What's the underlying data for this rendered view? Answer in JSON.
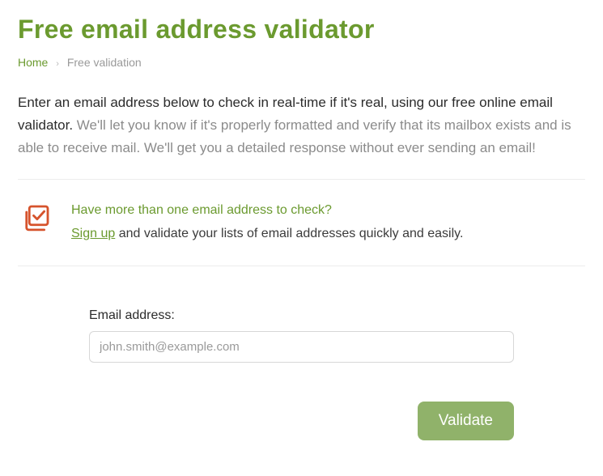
{
  "header": {
    "title": "Free email address validator"
  },
  "breadcrumb": {
    "home_label": "Home",
    "separator": "›",
    "current_label": "Free validation"
  },
  "intro": {
    "lead": "Enter an email address below to check in real-time if it's real, ",
    "sub": "using our free online email validator.",
    "rest": " We'll let you know if it's properly formatted and verify that its mailbox exists and is able to receive mail. We'll get you a detailed response without ever sending an email!"
  },
  "callout": {
    "icon_name": "multi-check-icon",
    "question": "Have more than one email address to check?",
    "signup_label": "Sign up",
    "rest": " and validate your lists of email addresses quickly and easily."
  },
  "form": {
    "email_label": "Email address:",
    "email_placeholder": "john.smith@example.com",
    "email_value": "",
    "validate_label": "Validate"
  },
  "colors": {
    "accent": "#6b9a2f",
    "icon": "#d6532c",
    "button_bg": "#90b26a"
  }
}
